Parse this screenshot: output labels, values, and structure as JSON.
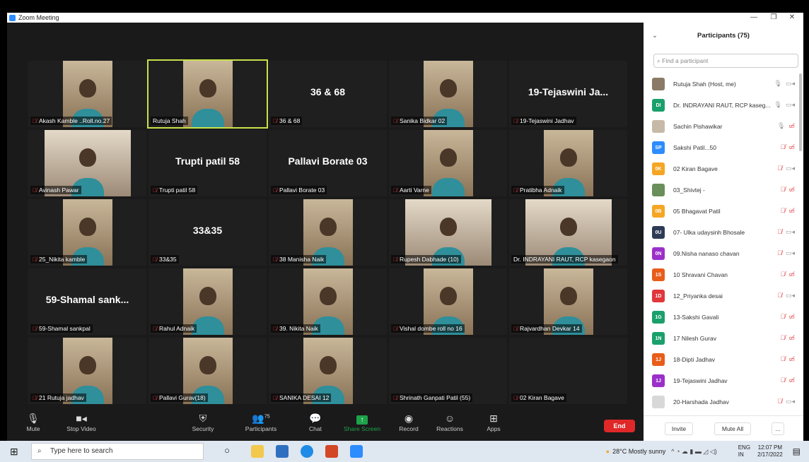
{
  "window": {
    "title": "Zoom Meeting"
  },
  "tiles": [
    {
      "label": "Akash  Kamble ..Roll.no.27",
      "video": true
    },
    {
      "label": "Rutuja Shah",
      "video": true,
      "active": true,
      "nomic": true
    },
    {
      "label": "36 & 68",
      "name": "36 & 68"
    },
    {
      "label": "Sanika Bidkar 02",
      "video": true
    },
    {
      "label": "19-Tejaswini Jadhav",
      "name": "19-Tejaswini  Ja..."
    },
    {
      "label": "Avinash Pawar",
      "video": true,
      "wide": true
    },
    {
      "label": "Trupti patil 58",
      "name": "Trupti patil 58"
    },
    {
      "label": "Pallavi Borate 03",
      "name": "Pallavi Borate 03"
    },
    {
      "label": "Aarti Varne",
      "video": true
    },
    {
      "label": "Pratibha Adnaik",
      "video": true
    },
    {
      "label": "25_Nikita kamble",
      "video": true
    },
    {
      "label": "33&35",
      "name": "33&35"
    },
    {
      "label": "38 Manisha Naik",
      "video": true
    },
    {
      "label": "Rupesh Dabhade (10)",
      "video": true,
      "wide": true
    },
    {
      "label": "Dr. INDRAYANI RAUT, RCP kasegaon",
      "video": true,
      "wide": true,
      "nomic": true
    },
    {
      "label": "59-Shamal sankpal",
      "name": "59-Shamal  sank..."
    },
    {
      "label": "Rahul Adnaik",
      "video": true
    },
    {
      "label": "39. Nikita  Naik",
      "video": true
    },
    {
      "label": "Vishal dombe roll no 16",
      "video": true
    },
    {
      "label": "Rajvardhan Devkar 14",
      "video": true
    },
    {
      "label": "21 Rutuja jadhav",
      "video": true
    },
    {
      "label": "Pallavi Gurav(18)",
      "video": true
    },
    {
      "label": "SANIKA DESAI 12",
      "video": true
    },
    {
      "label": "Shrinath Ganpati Patil (55)"
    },
    {
      "label": "02 Kiran Bagave"
    }
  ],
  "toolbar": {
    "mute": "Mute",
    "stop_video": "Stop Video",
    "security": "Security",
    "participants": "Participants",
    "participants_count": "75",
    "chat": "Chat",
    "share": "Share Screen",
    "record": "Record",
    "reactions": "Reactions",
    "apps": "Apps",
    "end": "End"
  },
  "panel": {
    "title": "Participants (75)",
    "search_placeholder": "Find a participant",
    "invite": "Invite",
    "mute_all": "Mute All",
    "more": "...",
    "participants": [
      {
        "initials": "",
        "name": "Rutuja Shah (Host, me)",
        "color": "#8a7a66",
        "mic": true,
        "vid": true
      },
      {
        "initials": "DI",
        "name": "Dr. INDRAYANI RAUT, RCP kaseg...",
        "color": "#1aa06b",
        "mic": true,
        "vid": true
      },
      {
        "initials": "",
        "name": "Sachin Pishawikar",
        "color": "#c7b9a7",
        "mic": true,
        "vid": false
      },
      {
        "initials": "SP",
        "name": "Sakshi Patil...50",
        "color": "#2d8cff",
        "mic": false,
        "vid": false
      },
      {
        "initials": "0K",
        "name": "02 Kiran Bagave",
        "color": "#f5a623",
        "mic": false,
        "vid": true
      },
      {
        "initials": "",
        "name": "03_Shivtej -",
        "color": "#6a8f5a",
        "mic": false,
        "vid": false
      },
      {
        "initials": "0B",
        "name": "05 Bhagavat Patil",
        "color": "#f5a623",
        "mic": false,
        "vid": false
      },
      {
        "initials": "0U",
        "name": "07-  Ulka udaysinh Bhosale",
        "color": "#2e3b55",
        "mic": false,
        "vid": true
      },
      {
        "initials": "0N",
        "name": "09.Nisha nanaso chavan",
        "color": "#9b30c9",
        "mic": false,
        "vid": true
      },
      {
        "initials": "1S",
        "name": "10 Shravani Chavan",
        "color": "#e85d1a",
        "mic": false,
        "vid": false
      },
      {
        "initials": "1D",
        "name": "12_Priyanka desai",
        "color": "#e0373b",
        "mic": false,
        "vid": true
      },
      {
        "initials": "1G",
        "name": "13-Sakshi Gavali",
        "color": "#1aa06b",
        "mic": false,
        "vid": false
      },
      {
        "initials": "1N",
        "name": "17 Nilesh Gurav",
        "color": "#1aa06b",
        "mic": false,
        "vid": false
      },
      {
        "initials": "1J",
        "name": "18-Dipti Jadhav",
        "color": "#e85d1a",
        "mic": false,
        "vid": false
      },
      {
        "initials": "1J",
        "name": "19-Tejaswini Jadhav",
        "color": "#9b30c9",
        "mic": false,
        "vid": false
      },
      {
        "initials": "",
        "name": "20-Harshada Jadhav",
        "color": "#d8d8d8",
        "mic": false,
        "vid": true
      }
    ]
  },
  "taskbar": {
    "search": "Type here to search",
    "weather": "28°C  Mostly sunny",
    "lang": "ENG",
    "region": "IN",
    "time": "12:07 PM",
    "date": "2/17/2022"
  }
}
